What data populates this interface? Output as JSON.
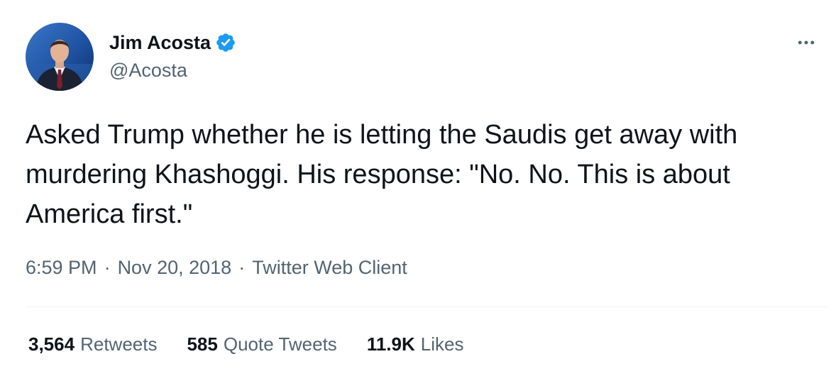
{
  "author": {
    "display_name": "Jim Acosta",
    "handle": "@Acosta",
    "verified": true,
    "avatar_icon": "avatar-photo"
  },
  "tweet": {
    "text": "Asked Trump whether he is letting the Saudis get away with murdering Khashoggi. His response: \"No. No. This is about America first.\"",
    "time": "6:59 PM",
    "separator": "·",
    "date": "Nov 20, 2018",
    "source": "Twitter Web Client"
  },
  "stats": {
    "retweets_count": "3,564",
    "retweets_label": "Retweets",
    "quotes_count": "585",
    "quotes_label": "Quote Tweets",
    "likes_count": "11.9K",
    "likes_label": "Likes"
  },
  "colors": {
    "text_primary": "#0f1419",
    "text_secondary": "#536471",
    "verified_blue": "#1d9bf0",
    "divider": "#eff3f4"
  },
  "icons": {
    "verified": "verified-badge-icon",
    "more": "more-horizontal-icon"
  }
}
